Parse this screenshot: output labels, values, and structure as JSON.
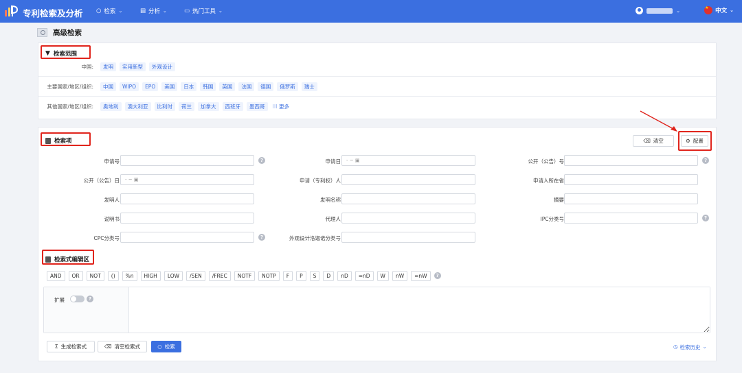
{
  "app": {
    "brand": "专利检索及分析"
  },
  "topnav": [
    {
      "label": "检索",
      "icon": "search-icon"
    },
    {
      "label": "分析",
      "icon": "chart-icon"
    },
    {
      "label": "热门工具",
      "icon": "monitor-icon"
    }
  ],
  "lang": {
    "label": "中文"
  },
  "page": {
    "title": "高级检索"
  },
  "scope": {
    "header": "检索范围",
    "rows": [
      {
        "label": "中国:",
        "items": [
          "发明",
          "实用新型",
          "外观设计"
        ]
      },
      {
        "label": "主要国家/地区/组织:",
        "items": [
          "中国",
          "WIPO",
          "EPO",
          "美国",
          "日本",
          "韩国",
          "英国",
          "法国",
          "德国",
          "俄罗斯",
          "瑞士"
        ]
      },
      {
        "label": "其他国家/地区/组织:",
        "items": [
          "奥地利",
          "澳大利亚",
          "比利时",
          "荷兰",
          "加拿大",
          "西班牙",
          "墨西哥"
        ]
      }
    ],
    "more_label": "更多"
  },
  "fields": {
    "header": "检索项",
    "clear_label": "清空",
    "config_label": "配置",
    "date_placeholder": "- ~",
    "items": [
      {
        "label": "申请号",
        "col": 0,
        "row": 0,
        "help": true
      },
      {
        "label": "申请日",
        "col": 1,
        "row": 0,
        "date": true
      },
      {
        "label": "公开（公告）号",
        "col": 2,
        "row": 0,
        "help": true
      },
      {
        "label": "公开（公告）日",
        "col": 0,
        "row": 1,
        "date": true
      },
      {
        "label": "申请（专利权）人",
        "col": 1,
        "row": 1
      },
      {
        "label": "申请人所在省",
        "col": 2,
        "row": 1
      },
      {
        "label": "发明人",
        "col": 0,
        "row": 2
      },
      {
        "label": "发明名称",
        "col": 1,
        "row": 2
      },
      {
        "label": "摘要",
        "col": 2,
        "row": 2
      },
      {
        "label": "说明书",
        "col": 0,
        "row": 3
      },
      {
        "label": "代理人",
        "col": 1,
        "row": 3
      },
      {
        "label": "IPC分类号",
        "col": 2,
        "row": 3,
        "help": true
      },
      {
        "label": "CPC分类号",
        "col": 0,
        "row": 4,
        "help": true
      },
      {
        "label": "外观设计洛迦诺分类号",
        "col": 1,
        "row": 4
      }
    ]
  },
  "editor": {
    "header": "检索式编辑区",
    "operators": [
      "AND",
      "OR",
      "NOT",
      "()",
      "%n",
      "HIGH",
      "LOW",
      "/SEN",
      "/FREC",
      "NOTF",
      "NOTP",
      "F",
      "P",
      "S",
      "D",
      "nD",
      "=nD",
      "W",
      "nW",
      "=nW"
    ],
    "expand_label": "扩展",
    "generate_label": "生成检索式",
    "clear_label": "清空检索式",
    "search_label": "检索",
    "history_label": "检索历史"
  },
  "colors": {
    "primary": "#3b6fe0",
    "highlight": "#e0241c"
  }
}
